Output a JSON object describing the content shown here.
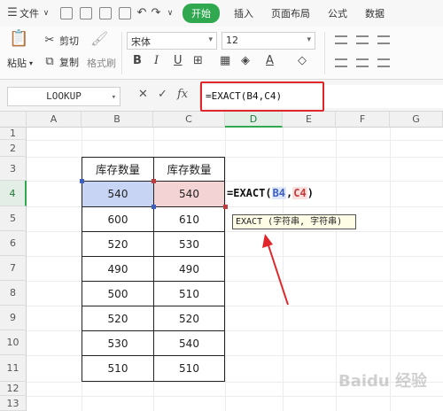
{
  "menu": {
    "file_label": "文件",
    "tabs": [
      "开始",
      "插入",
      "页面布局",
      "公式",
      "数据"
    ]
  },
  "ribbon": {
    "cut_label": "剪切",
    "copy_label": "复制",
    "paste_label": "粘贴",
    "format_painter_label": "格式刷",
    "font_name": "宋体",
    "font_size": "12"
  },
  "formula_bar": {
    "name_box": "LOOKUP",
    "formula": "=EXACT(B4,C4)"
  },
  "grid": {
    "columns": [
      "A",
      "B",
      "C",
      "D",
      "E",
      "F",
      "G"
    ],
    "rows": [
      "1",
      "2",
      "3",
      "4",
      "5",
      "6",
      "7",
      "8",
      "9",
      "10",
      "11",
      "12",
      "13"
    ],
    "selected_column": "D",
    "selected_row": "4"
  },
  "table": {
    "headers": [
      "库存数量",
      "库存数量"
    ],
    "rows": [
      [
        "540",
        "540"
      ],
      [
        "600",
        "610"
      ],
      [
        "520",
        "530"
      ],
      [
        "490",
        "490"
      ],
      [
        "500",
        "510"
      ],
      [
        "520",
        "520"
      ],
      [
        "530",
        "540"
      ],
      [
        "510",
        "510"
      ]
    ]
  },
  "active_cell": {
    "prefix": "=EXACT(",
    "ref1": "B4",
    "comma": ",",
    "ref2": "C4",
    "suffix": ")"
  },
  "tooltip": "EXACT (字符串, 字符串)",
  "watermark": "Baidu 经验",
  "colors": {
    "accent_green": "#2fa84f",
    "highlight_red": "#e0262a",
    "ref_blue": "#3c5fc0",
    "ref_red": "#c03c3c"
  }
}
